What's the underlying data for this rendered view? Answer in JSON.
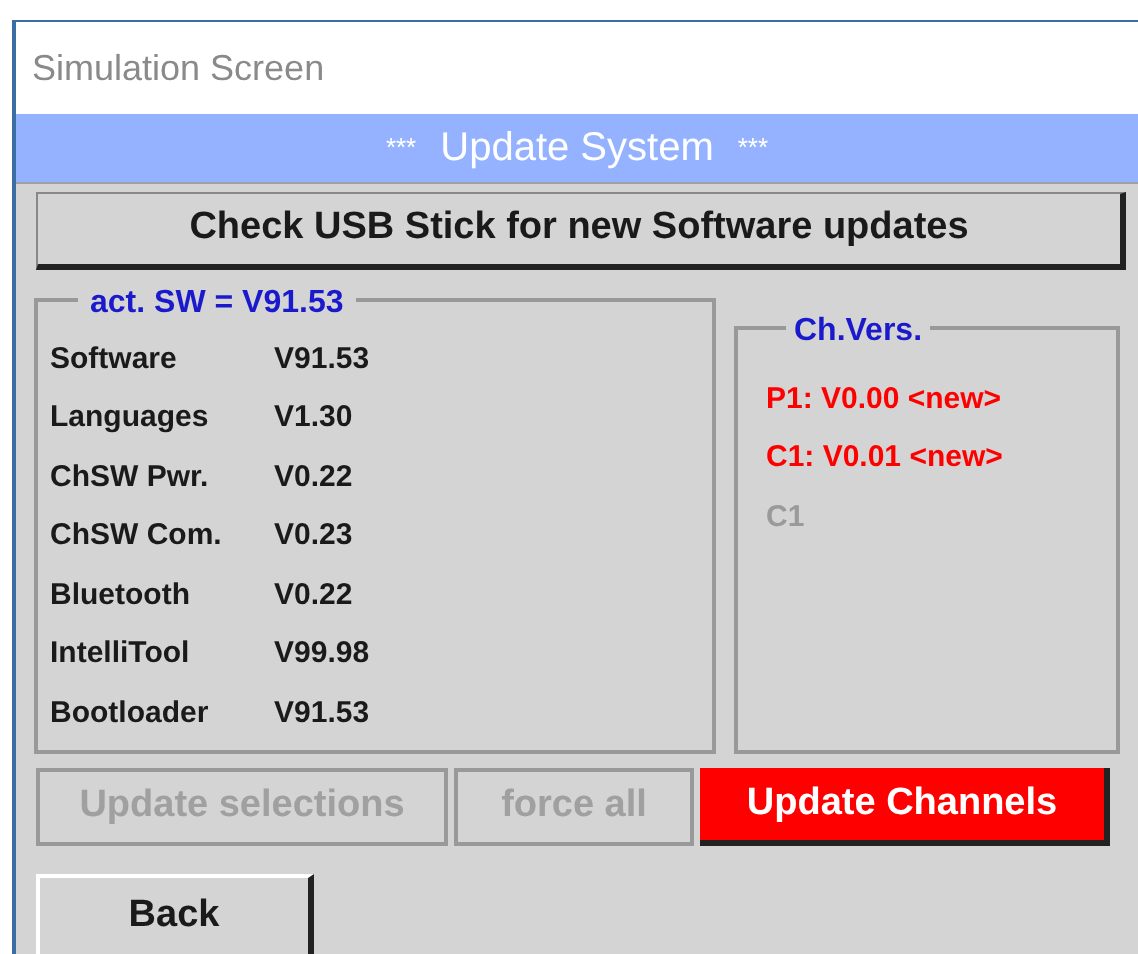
{
  "window": {
    "title": "Simulation Screen"
  },
  "header": {
    "title": "Update System",
    "decoration": "***"
  },
  "check_button": {
    "label": "Check USB Stick for new Software updates"
  },
  "software_group": {
    "legend": "act. SW = V91.53",
    "rows": [
      {
        "name": "Software",
        "version": "V91.53"
      },
      {
        "name": "Languages",
        "version": "V1.30"
      },
      {
        "name": "ChSW Pwr.",
        "version": "V0.22"
      },
      {
        "name": "ChSW Com.",
        "version": "V0.23"
      },
      {
        "name": "Bluetooth",
        "version": "V0.22"
      },
      {
        "name": "IntelliTool",
        "version": "V99.98"
      },
      {
        "name": "Bootloader",
        "version": "V91.53"
      }
    ]
  },
  "channel_group": {
    "legend": "Ch.Vers.",
    "items": [
      {
        "text": "P1: V0.00 <new>",
        "kind": "new"
      },
      {
        "text": "C1: V0.01 <new>",
        "kind": "new"
      },
      {
        "text": "C1",
        "kind": "inactive"
      }
    ]
  },
  "actions": [
    {
      "label": "Update selections",
      "disabled": true,
      "kind": "normal"
    },
    {
      "label": "force all",
      "disabled": true,
      "kind": "normal"
    },
    {
      "label": "Update Channels",
      "disabled": false,
      "kind": "alert"
    }
  ],
  "back_button": {
    "label": "Back"
  }
}
